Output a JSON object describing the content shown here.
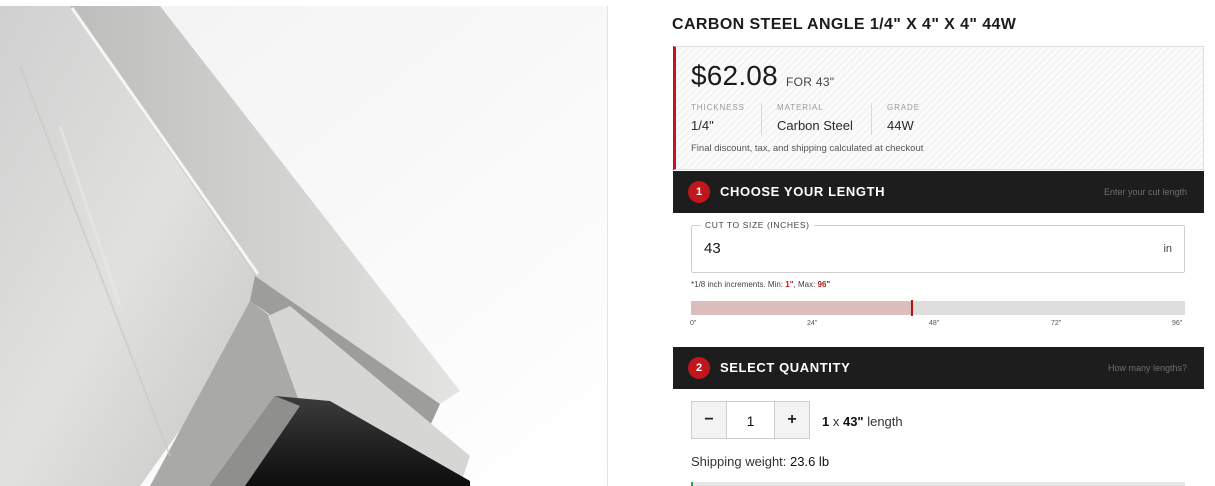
{
  "product": {
    "title": "CARBON STEEL ANGLE 1/4\" X 4\" X 4\" 44W",
    "price": "$62.08",
    "price_for": "FOR 43\"",
    "specs": [
      {
        "label": "THICKNESS",
        "value": "1/4\""
      },
      {
        "label": "MATERIAL",
        "value": "Carbon Steel"
      },
      {
        "label": "GRADE",
        "value": "44W"
      }
    ],
    "price_note": "Final discount, tax, and shipping calculated at checkout"
  },
  "length_section": {
    "step": "1",
    "title": "CHOOSE YOUR LENGTH",
    "hint": "Enter your cut length",
    "field_label": "CUT TO SIZE (INCHES)",
    "value": "43",
    "unit": "in",
    "note_prefix": "*1/8 inch increments. Min: ",
    "min": "1\"",
    "note_mid": ", Max: ",
    "max": "96\"",
    "slider": {
      "value": 43,
      "min": 0,
      "max": 96
    },
    "ticks": [
      "0\"",
      "24\"",
      "48\"",
      "72\"",
      "96\""
    ]
  },
  "quantity_section": {
    "step": "2",
    "title": "SELECT QUANTITY",
    "hint": "How many lengths?",
    "decrement": "−",
    "increment": "+",
    "quantity": "1",
    "summary_count": "1",
    "summary_x": " x ",
    "summary_length": "43\"",
    "summary_suffix": " length",
    "shipping_label": "Shipping weight: ",
    "shipping_value": "23.6 lb"
  },
  "colors": {
    "accent": "#c0161c",
    "dark_bar": "#1d1d1d",
    "slider_fill": "#ddbcbc"
  },
  "image": {
    "subject": "steel-angle-product-photo"
  }
}
